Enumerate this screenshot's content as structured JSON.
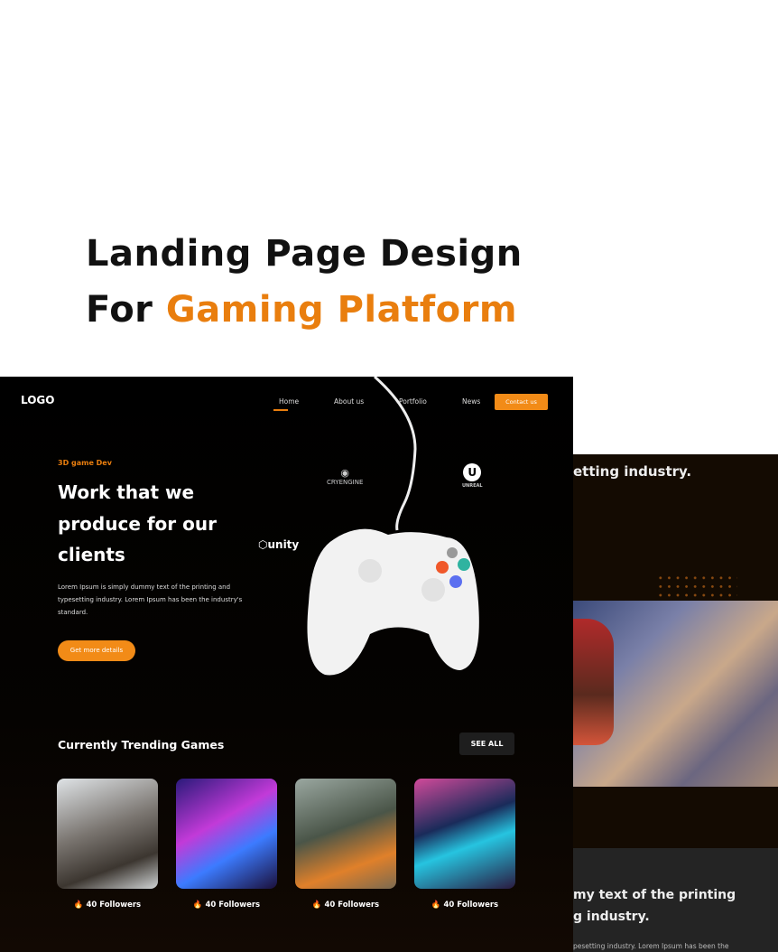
{
  "heading": {
    "line1": "Landing Page Design",
    "line2_prefix": "For",
    "line2_accent": "Gaming Platform"
  },
  "colors": {
    "accent": "#e97e0e",
    "button": "#f28b17"
  },
  "back_preview": {
    "text1": "etting industry.",
    "heading1": "my text of the printing",
    "heading2": "g industry.",
    "body": "pesetting industry. Lorem Ipsum has been the"
  },
  "nav": {
    "logo": "LOGO",
    "items": [
      "Home",
      "About us",
      "Portfolio",
      "News"
    ],
    "contact": "Contact us"
  },
  "hero": {
    "eyebrow": "3D game Dev",
    "title": "Work that we produce for our clients",
    "description": "Lorem Ipsum is simply dummy text of the printing and typesetting industry. Lorem Ipsum has been the industry's standard.",
    "cta": "Get more details"
  },
  "brands": {
    "cryengine": "CRYENGINE",
    "unreal": "UNREAL",
    "unity": "unity"
  },
  "trending": {
    "title": "Currently Trending Games",
    "see_all": "SEE ALL",
    "games": [
      {
        "followers": "40 Followers"
      },
      {
        "followers": "40 Followers"
      },
      {
        "followers": "40 Followers"
      },
      {
        "followers": "40 Followers"
      }
    ]
  }
}
